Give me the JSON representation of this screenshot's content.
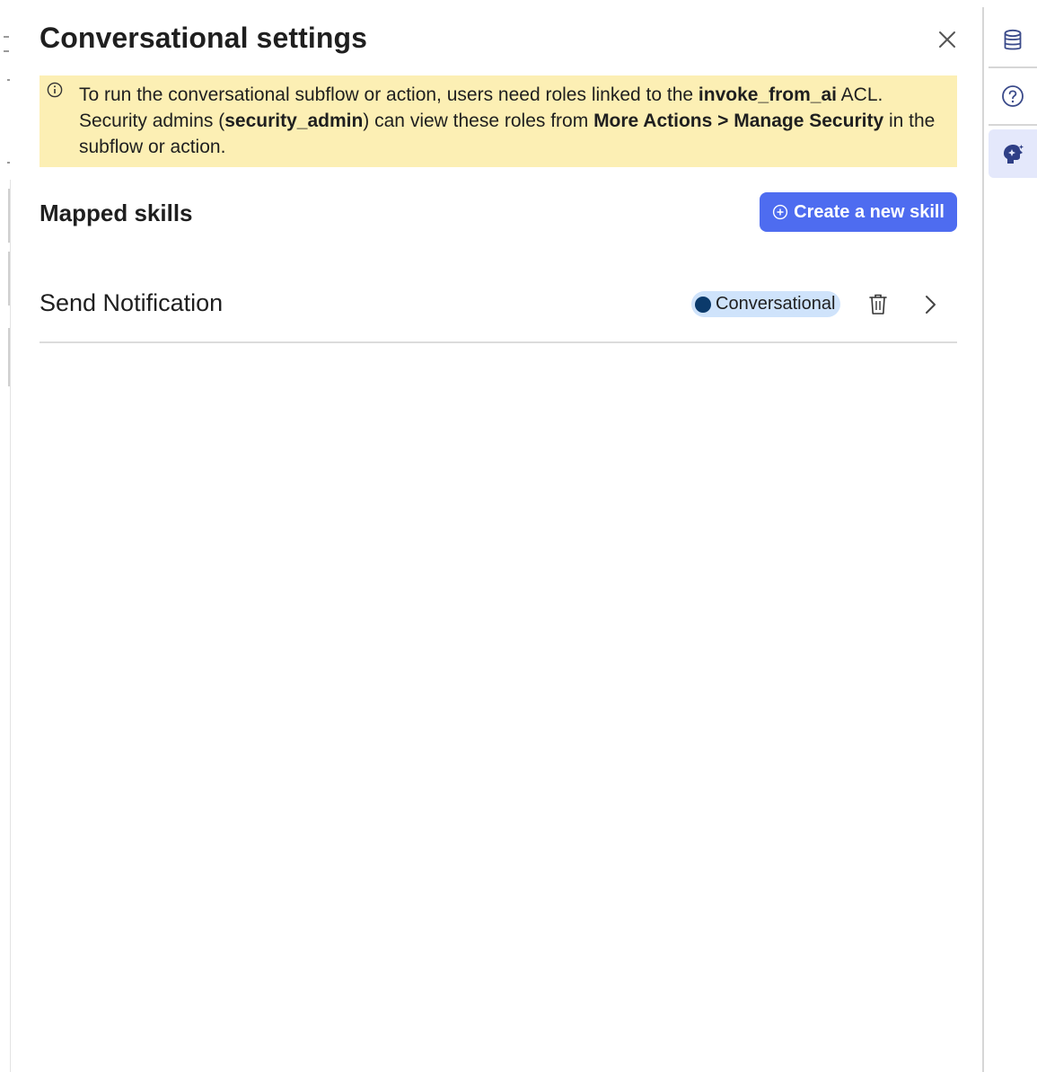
{
  "panel": {
    "title": "Conversational settings",
    "close_label": "×"
  },
  "notice": {
    "icon": "info-icon",
    "text_1": "To run the conversational subflow or action, users need roles linked to the ",
    "bold_1": "invoke_from_ai",
    "text_2": " ACL. Security admins (",
    "bold_2": "security_admin",
    "text_3": ") can view these roles from ",
    "bold_3": "More Actions > Manage Security",
    "text_4": " in the subflow or action.",
    "background": "#fcefb4"
  },
  "mapped_skills": {
    "title": "Mapped skills",
    "create_button_label": "Create a new skill",
    "create_button_icon": "plus-circle-icon",
    "accent": "#4e6cf0",
    "items": [
      {
        "name": "Send Notification",
        "badge": "Conversational",
        "badge_color": "#cfe3fb",
        "dot_color": "#0b3a6b"
      }
    ]
  },
  "rail": {
    "items": [
      {
        "icon": "database-icon"
      },
      {
        "icon": "help-icon"
      },
      {
        "icon": "ai-skill-icon",
        "active": true
      }
    ]
  }
}
